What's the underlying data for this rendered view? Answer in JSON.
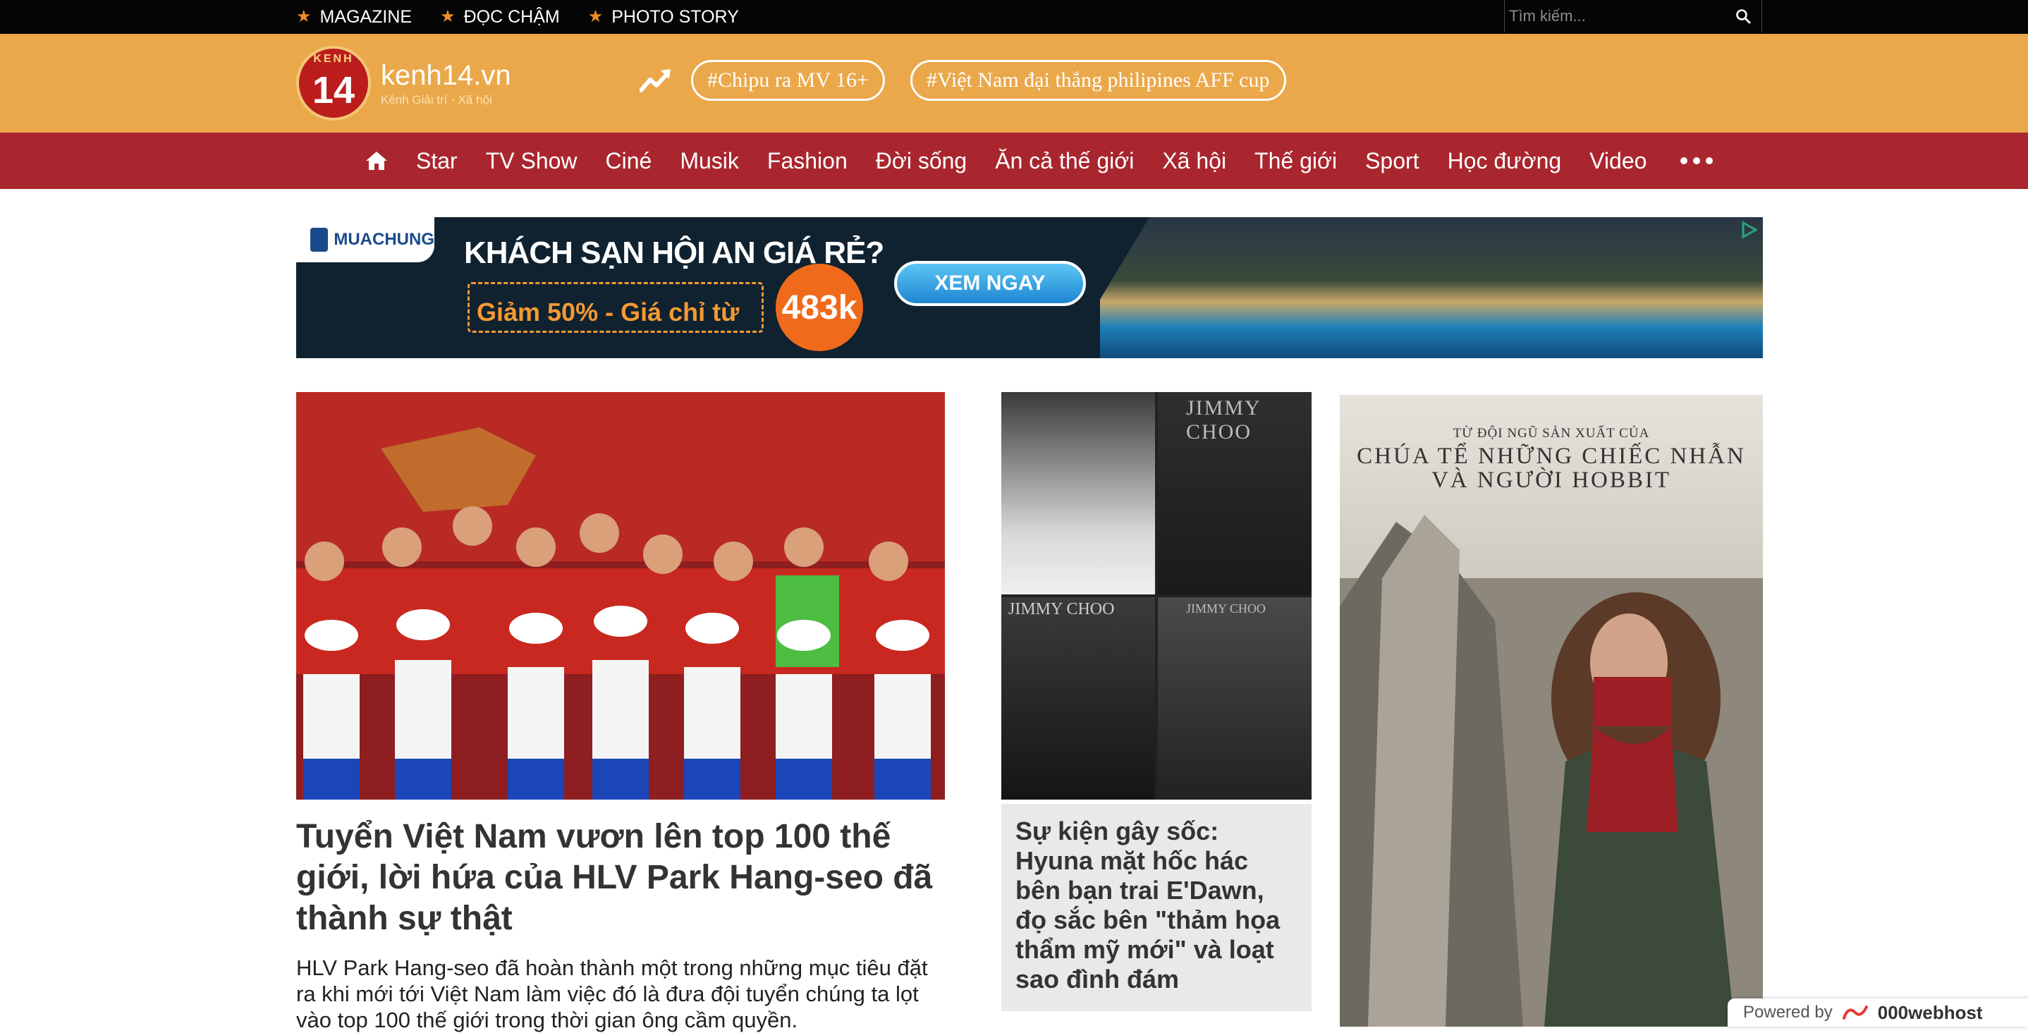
{
  "topbar": {
    "links": [
      {
        "label": "MAGAZINE"
      },
      {
        "label": "ĐỌC CHẬM"
      },
      {
        "label": "PHOTO STORY"
      }
    ],
    "search_placeholder": "Tìm kiếm..."
  },
  "header": {
    "logo_badge_top": "KENH",
    "logo_badge_num": "14",
    "logo_name": "kenh14.vn",
    "logo_tagline": "Kênh Giải trí - Xã hội",
    "trending_tags": [
      "#Chipu ra MV 16+",
      "#Việt Nam đại thắng philipines AFF cup"
    ]
  },
  "nav": {
    "items": [
      "Star",
      "TV Show",
      "Ciné",
      "Musik",
      "Fashion",
      "Đời sống",
      "Ăn cả thế giới",
      "Xã hội",
      "Thế giới",
      "Sport",
      "Học đường",
      "Video"
    ]
  },
  "ad": {
    "brand": "MUACHUNG",
    "headline": "KHÁCH SẠN HỘI AN GIÁ RẺ?",
    "promo": "Giảm 50% - Giá chỉ từ",
    "price": "483k",
    "cta": "XEM NGAY"
  },
  "main_story": {
    "title": "Tuyển Việt Nam vươn lên top 100 thế giới, lời hứa của HLV Park Hang-seo đã thành sự thật",
    "sapo": "HLV Park Hang-seo đã hoàn thành một trong những mục tiêu đặt ra khi mới tới Việt Nam làm việc đó là đưa đội tuyển chúng ta lọt vào top 100 thế giới trong thời gian ông cầm quyền."
  },
  "side_story": {
    "title": "Sự kiện gây sốc: Hyuna mặt hốc hác bên bạn trai E'Dawn, đọ sắc bên \"thảm họa thẩm mỹ mới\" và loạt sao đình đám",
    "photo_text": [
      "JIMMY CHOO",
      "JIMMY CHOO",
      "JIMMY CHOO"
    ]
  },
  "poster": {
    "tagline": "TỪ ĐỘI NGŨ SẢN XUẤT CỦA",
    "movie": "CHÚA TỂ NHỮNG CHIẾC NHẪN",
    "movie2": "VÀ NGƯỜI HOBBIT"
  },
  "footer_badge": {
    "powered": "Powered by",
    "host": "000webhost"
  },
  "colors": {
    "topbar": "#050505",
    "header": "#eaa84a",
    "nav": "#a9262e",
    "accent_star": "#f08c2a"
  }
}
